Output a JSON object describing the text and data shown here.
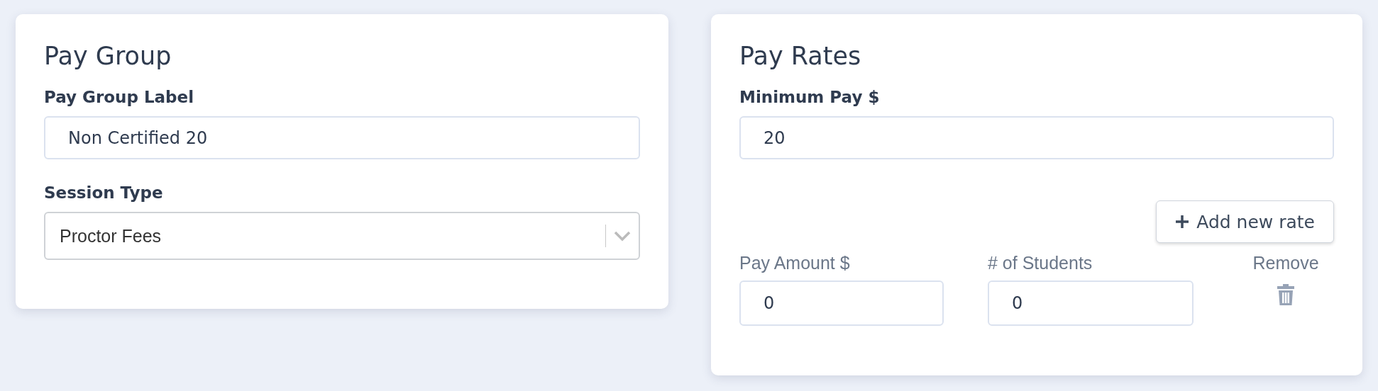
{
  "pay_group": {
    "title": "Pay Group",
    "label_field": {
      "label": "Pay Group Label",
      "value": "Non Certified 20"
    },
    "session_type": {
      "label": "Session Type",
      "value": "Proctor Fees"
    }
  },
  "pay_rates": {
    "title": "Pay Rates",
    "minimum_pay": {
      "label": "Minimum Pay $",
      "value": "20"
    },
    "add_button": "Add new rate",
    "columns": [
      "Pay Amount $",
      "# of Students",
      "Remove"
    ],
    "rows": [
      {
        "pay_amount": "0",
        "students": "0"
      }
    ]
  }
}
